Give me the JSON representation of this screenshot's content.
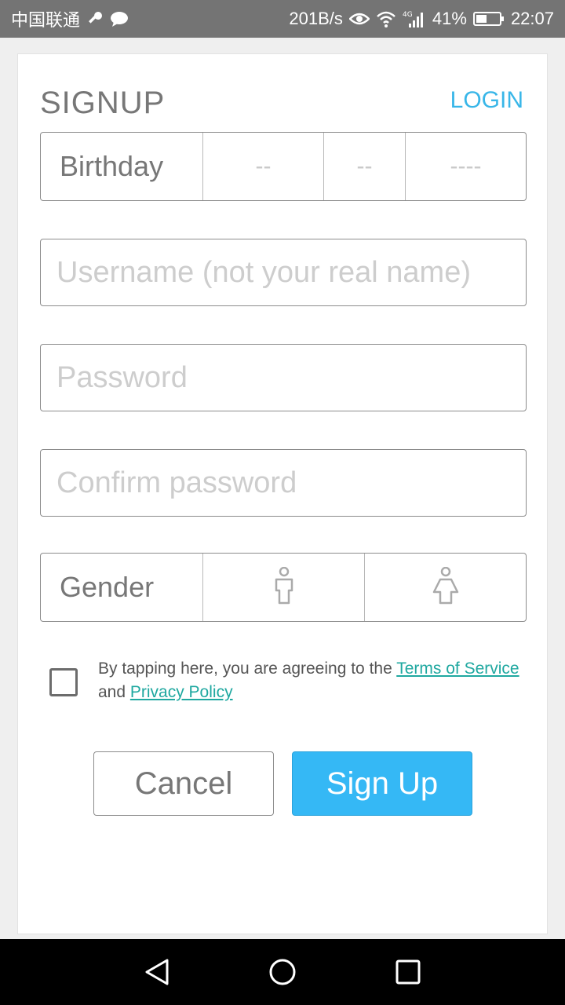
{
  "status_bar": {
    "carrier": "中国联通",
    "speed": "201B/s",
    "network": "4G",
    "battery": "41%",
    "time": "22:07"
  },
  "header": {
    "title": "SIGNUP",
    "login_label": "LOGIN"
  },
  "birthday": {
    "label": "Birthday",
    "month_placeholder": "--",
    "day_placeholder": "--",
    "year_placeholder": "----"
  },
  "fields": {
    "username_placeholder": "Username (not your real name)",
    "password_placeholder": "Password",
    "confirm_placeholder": "Confirm password"
  },
  "gender": {
    "label": "Gender",
    "options": [
      "male-icon",
      "female-icon"
    ]
  },
  "terms": {
    "text_before": "By tapping here, you are agreeing to the ",
    "tos_link": "Terms of Service",
    "and_text": "and ",
    "privacy_link": "Privacy Policy",
    "checked": false
  },
  "buttons": {
    "cancel_label": "Cancel",
    "signup_label": "Sign Up"
  },
  "colors": {
    "accent": "#35b8f5",
    "link": "#1fa8a0",
    "login": "#38b6e8"
  }
}
